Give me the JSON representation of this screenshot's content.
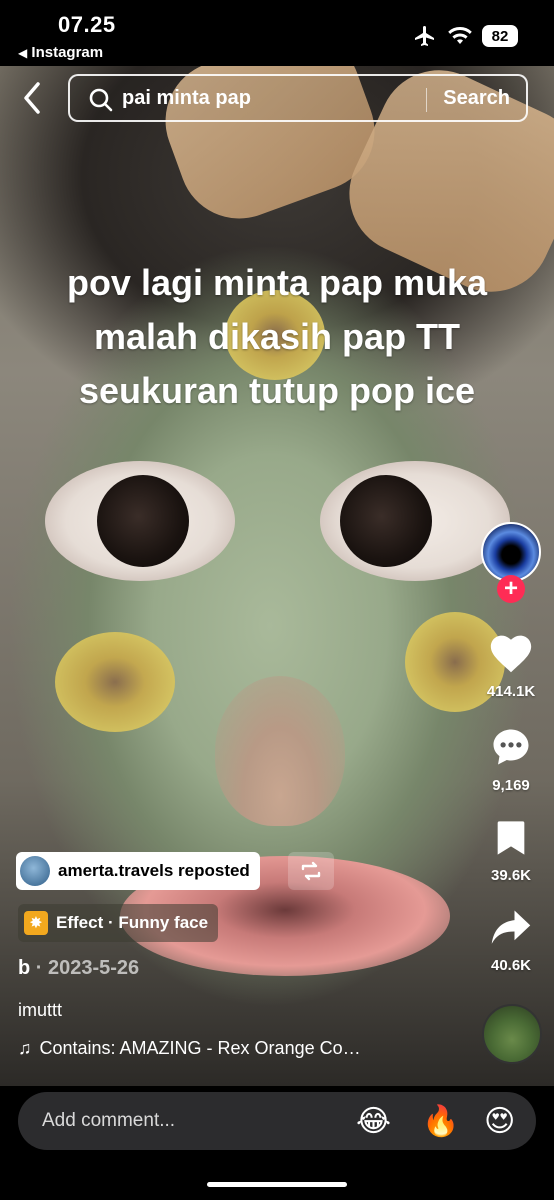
{
  "status_bar": {
    "time": "07.25",
    "back_app_label": "Instagram",
    "battery": "82"
  },
  "search": {
    "query": "pai minta pap",
    "button_label": "Search"
  },
  "caption": {
    "line1": "pov lagi minta pap muka",
    "line2": "malah dikasih pap TT",
    "line3": "seukuran tutup pop ice"
  },
  "actions": {
    "likes": "414.1K",
    "comments": "9,169",
    "bookmarks": "39.6K",
    "shares": "40.6K"
  },
  "post": {
    "repost_label": "amerta.travels reposted",
    "effect_label": "Effect · Funny face",
    "author": "b",
    "separator": " · ",
    "date": "2023-5-26",
    "description": "imuttt",
    "music": "Contains: AMAZING - Rex Orange Co…"
  },
  "comment_bar": {
    "placeholder": "Add comment...",
    "emojis": [
      "😂",
      "🔥",
      "😍"
    ]
  },
  "colors": {
    "follow_accent": "#fe2c55",
    "effect_badge": "#f2a81e"
  }
}
